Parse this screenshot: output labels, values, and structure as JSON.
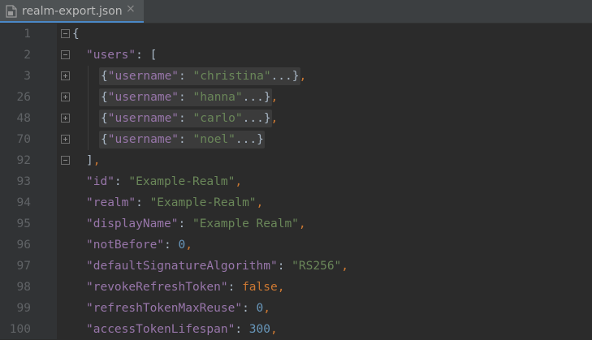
{
  "tab": {
    "filename": "realm-export.json",
    "close": "×"
  },
  "lines": [
    {
      "no": "1",
      "fold": "open",
      "parts": [
        [
          "p",
          "{"
        ]
      ]
    },
    {
      "no": "2",
      "fold": "open",
      "parts": [
        [
          "k",
          "\"users\""
        ],
        [
          "p",
          ": ["
        ]
      ]
    },
    {
      "no": "3",
      "fold": "plus",
      "folded": true,
      "parts": [
        [
          "p",
          "{"
        ],
        [
          "k",
          "\"username\""
        ],
        [
          "p",
          ": "
        ],
        [
          "s",
          "\"christina\""
        ],
        [
          "p",
          "...}"
        ],
        [
          "c",
          ","
        ]
      ]
    },
    {
      "no": "26",
      "fold": "plus",
      "folded": true,
      "parts": [
        [
          "p",
          "{"
        ],
        [
          "k",
          "\"username\""
        ],
        [
          "p",
          ": "
        ],
        [
          "s",
          "\"hanna\""
        ],
        [
          "p",
          "...}"
        ],
        [
          "c",
          ","
        ]
      ]
    },
    {
      "no": "48",
      "fold": "plus",
      "folded": true,
      "parts": [
        [
          "p",
          "{"
        ],
        [
          "k",
          "\"username\""
        ],
        [
          "p",
          ": "
        ],
        [
          "s",
          "\"carlo\""
        ],
        [
          "p",
          "...}"
        ],
        [
          "c",
          ","
        ]
      ]
    },
    {
      "no": "70",
      "fold": "plus",
      "folded": true,
      "parts": [
        [
          "p",
          "{"
        ],
        [
          "k",
          "\"username\""
        ],
        [
          "p",
          ": "
        ],
        [
          "s",
          "\"noel\""
        ],
        [
          "p",
          "...}"
        ]
      ]
    },
    {
      "no": "92",
      "fold": "close",
      "parts": [
        [
          "p",
          "]"
        ],
        [
          "c",
          ","
        ]
      ]
    },
    {
      "no": "93",
      "fold": "",
      "parts": [
        [
          "k",
          "\"id\""
        ],
        [
          "p",
          ": "
        ],
        [
          "s",
          "\"Example-Realm\""
        ],
        [
          "c",
          ","
        ]
      ]
    },
    {
      "no": "94",
      "fold": "",
      "parts": [
        [
          "k",
          "\"realm\""
        ],
        [
          "p",
          ": "
        ],
        [
          "s",
          "\"Example-Realm\""
        ],
        [
          "c",
          ","
        ]
      ]
    },
    {
      "no": "95",
      "fold": "",
      "parts": [
        [
          "k",
          "\"displayName\""
        ],
        [
          "p",
          ": "
        ],
        [
          "s",
          "\"Example Realm\""
        ],
        [
          "c",
          ","
        ]
      ]
    },
    {
      "no": "96",
      "fold": "",
      "parts": [
        [
          "k",
          "\"notBefore\""
        ],
        [
          "p",
          ": "
        ],
        [
          "n",
          "0"
        ],
        [
          "c",
          ","
        ]
      ]
    },
    {
      "no": "97",
      "fold": "",
      "parts": [
        [
          "k",
          "\"defaultSignatureAlgorithm\""
        ],
        [
          "p",
          ": "
        ],
        [
          "s",
          "\"RS256\""
        ],
        [
          "c",
          ","
        ]
      ]
    },
    {
      "no": "98",
      "fold": "",
      "parts": [
        [
          "k",
          "\"revokeRefreshToken\""
        ],
        [
          "p",
          ": "
        ],
        [
          "kw",
          "false"
        ],
        [
          "c",
          ","
        ]
      ]
    },
    {
      "no": "99",
      "fold": "",
      "parts": [
        [
          "k",
          "\"refreshTokenMaxReuse\""
        ],
        [
          "p",
          ": "
        ],
        [
          "n",
          "0"
        ],
        [
          "c",
          ","
        ]
      ]
    },
    {
      "no": "100",
      "fold": "",
      "parts": [
        [
          "k",
          "\"accessTokenLifespan\""
        ],
        [
          "p",
          ": "
        ],
        [
          "n",
          "300"
        ],
        [
          "c",
          ","
        ]
      ]
    }
  ]
}
